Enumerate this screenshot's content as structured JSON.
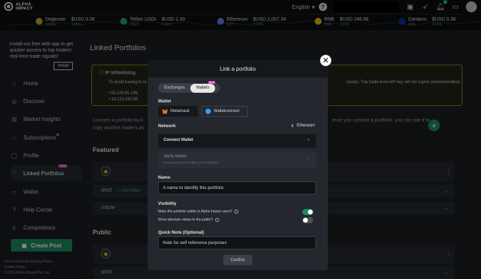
{
  "header": {
    "logo_line1": "ALPHA",
    "logo_line2": "IMPACT",
    "language": "English",
    "help_icon": "question-circle-icon"
  },
  "ticker": [
    {
      "name": "Dogecoin",
      "symbol": "DOGE",
      "price": "$USD 0.08",
      "change": "2.25%",
      "color": "#c2a633",
      "neg": false
    },
    {
      "name": "Tether USDt",
      "symbol": "USDT",
      "price": "$USD 1.00",
      "change": "0.01%",
      "color": "#26a17b",
      "neg": true
    },
    {
      "name": "Ethereum",
      "symbol": "ETH",
      "price": "$USD 2,007.34",
      "change": "2.12%",
      "color": "#627eea",
      "neg": false
    },
    {
      "name": "BNB",
      "symbol": "BNB",
      "price": "$USD 246.66",
      "change": "1.01%",
      "color": "#f0b90b",
      "neg": false
    },
    {
      "name": "Cardano",
      "symbol": "ADA",
      "price": "$USD 0.38",
      "change": "2.74%",
      "color": "#0033ad",
      "neg": false
    }
  ],
  "sidebar": {
    "promo": "Install our free web app to get quicker access to top traders' real-time trade signals!",
    "install_label": "Install",
    "items": [
      {
        "label": "Home",
        "icon": "home-icon"
      },
      {
        "label": "Discover",
        "icon": "compass-icon"
      },
      {
        "label": "Market Insights",
        "icon": "chart-icon"
      },
      {
        "label": "Subscriptions",
        "icon": "star-icon"
      },
      {
        "label": "Profile",
        "icon": "user-icon"
      },
      {
        "label": "Linked Portfolios",
        "icon": "chart-line-icon"
      },
      {
        "label": "Wallet",
        "icon": "wallet-icon"
      },
      {
        "label": "Help Center",
        "icon": "help-icon"
      },
      {
        "label": "Competitions",
        "icon": "trophy-icon"
      }
    ],
    "new_badge": "NEW",
    "create_post": "Create Post",
    "footer": [
      "Terms of Service  Privacy Policy",
      "Cookie Policy",
      "© 2023 Alpha Impact Pte. Ltd."
    ]
  },
  "main": {
    "title": "Linked Portfolios",
    "ip_title": "IP Whitelisting",
    "ip_text_left": "To avoid having to re",
    "ip_text_right": "resses. The trade-level API key will not expire (recommended).",
    "ip_list": [
      "52.220.91.198",
      "13.213.195.58"
    ],
    "connect_left_1": "Connect a portfolio by li",
    "connect_left_2": "copy another trader's po",
    "connect_right_1": "ence you connect a portfolio, you can use it to",
    "featured": "Featured",
    "public": "Public",
    "spot": "SPOT",
    "featured_badge": "FEATURED",
    "usdm": "USD-M"
  },
  "modal": {
    "title": "Link a portfolio",
    "tab_exchanges": "Exchanges",
    "tab_wallets": "Wallets",
    "tab_new": "NEW",
    "wallet_label": "Wallet",
    "metamask": "Metamask",
    "walletconnect": "Walletconnect",
    "network_label": "Network",
    "network_value": "Ethereum",
    "connect_wallet": "Connect Wallet",
    "verify_wallet": "Verify Wallet",
    "verify_sub": "Prove you are the holder of the address",
    "name_label": "Name",
    "name_placeholder": "A name to identify this portfolio",
    "visibility_label": "Visibility",
    "vis_visible": "Make this portfolio visible to Alpha Impact users?",
    "vis_absolute": "Show absolute values to the public?",
    "vis_visible_on": true,
    "vis_absolute_on": false,
    "note_label": "Quick Note (Optional)",
    "note_placeholder": "Note for self reference purposes",
    "confirm": "Confirm"
  }
}
